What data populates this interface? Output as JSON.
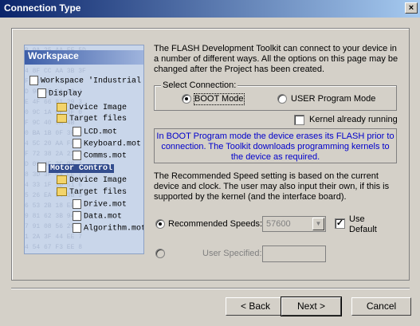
{
  "window": {
    "title": "Connection Type",
    "close_label": "×"
  },
  "illustration": {
    "header": "Workspace",
    "items": [
      "Workspace 'Industrial Co",
      "Display",
      "Device Image",
      "Target files",
      "LCD.mot",
      "Keyboard.mot",
      "Comms.mot",
      "Motor Control",
      "Device Image",
      "Target files",
      "Drive.mot",
      "Data.mot",
      "Algorithm.mot"
    ],
    "hex_lines": [
      "B 0A 25 AA FF 5D",
      "3 E5 4D 5D FF 3D",
      "4 8F CC AA 3B 3F",
      "F 73 C3 F2 12 4",
      "D 90 6E 2A 00 4",
      "E 4F 66 81 29 3",
      "0 9C 1A 0F 3F 0",
      "F 9C 40 9A 4B",
      "0 BA 1B 0F 3F 0",
      "4 5C 20 AA FF 5",
      "F 72 38 2A 21 0",
      "D 09 4E 2C 00 4",
      "8 3D 3F 44 EE 7",
      "4 33 1F 3D 51 6",
      "5 26 EA 54 3B 3",
      "6 53 2B 18 EE 8",
      "9 81 62 3B 94 9",
      "7 91 08 56 2C 3",
      "1 2A 3F 44 EE 7",
      "4 54 67 F3 EE 8"
    ]
  },
  "intro_text": "The FLASH Development Toolkit can connect to your device in a number of different ways. All the options on this page may be changed after the Project has been created.",
  "select_connection": {
    "label": "Select Connection:",
    "boot_mode": "BOOT Mode",
    "user_mode": "USER Program Mode",
    "selected": "BOOT Mode"
  },
  "kernel_running": {
    "label": "Kernel already running",
    "checked": false
  },
  "info_text": "In BOOT Program mode the device erases its FLASH prior to connection. The Toolkit downloads programming kernels to the device as required.",
  "speed_text": "The Recommended Speed setting is based on the current device and clock. The user may also input their own, if this is supported by the kernel (and the interface board).",
  "recommended_speeds": {
    "label": "Recommended Speeds:",
    "value": "57600",
    "selected": true
  },
  "use_default": {
    "label": "Use Default",
    "checked": true
  },
  "user_specified": {
    "label": "User Specified:",
    "value": ""
  },
  "buttons": {
    "back": "< Back",
    "next": "Next >",
    "cancel": "Cancel"
  }
}
